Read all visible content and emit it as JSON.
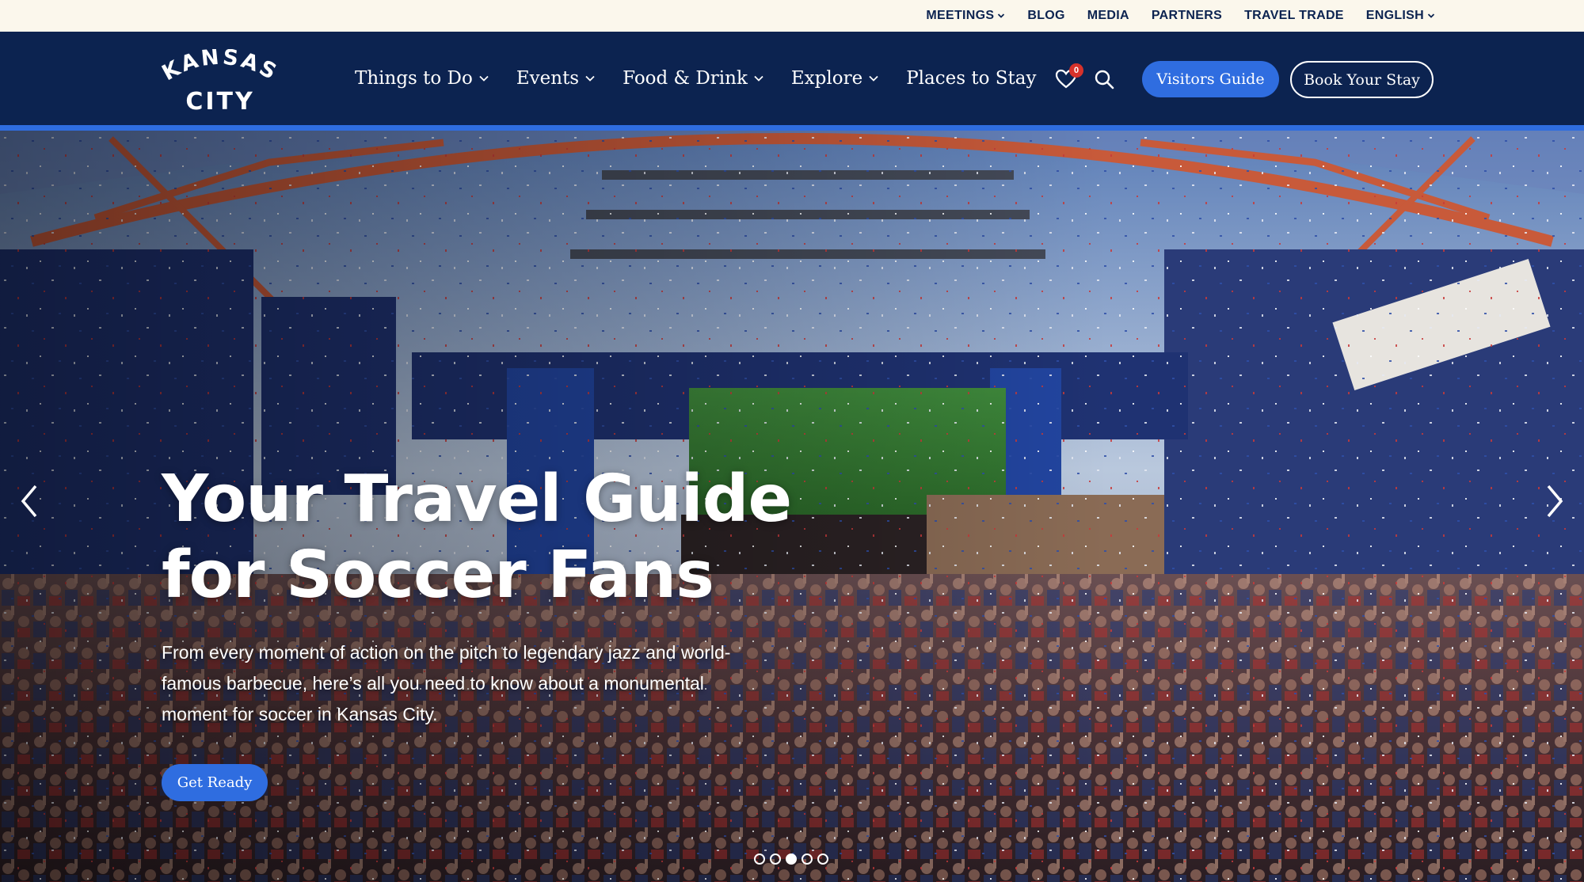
{
  "utility_nav": {
    "items": [
      {
        "label": "MEETINGS",
        "has_dropdown": true
      },
      {
        "label": "BLOG",
        "has_dropdown": false
      },
      {
        "label": "MEDIA",
        "has_dropdown": false
      },
      {
        "label": "PARTNERS",
        "has_dropdown": false
      },
      {
        "label": "TRAVEL TRADE",
        "has_dropdown": false
      },
      {
        "label": "ENGLISH",
        "has_dropdown": true
      }
    ]
  },
  "brand": {
    "logo_line1": "KANSAS",
    "logo_line2": "CITY"
  },
  "main_nav": {
    "items": [
      {
        "label": "Things to Do",
        "has_dropdown": true
      },
      {
        "label": "Events",
        "has_dropdown": true
      },
      {
        "label": "Food & Drink",
        "has_dropdown": true
      },
      {
        "label": "Explore",
        "has_dropdown": true
      },
      {
        "label": "Places to Stay",
        "has_dropdown": false
      }
    ],
    "favorites_count": "0",
    "visitors_guide_label": "Visitors Guide",
    "book_stay_label": "Book Your Stay"
  },
  "hero": {
    "title_line1": "Your Travel Guide",
    "title_line2": "for Soccer Fans",
    "subtitle": "From every moment of action on the pitch to legendary jazz and world-famous barbecue, here’s all you need to know about a monumental moment for soccer in Kansas City.",
    "cta_label": "Get Ready",
    "slides_total": 5,
    "active_slide": 3
  },
  "colors": {
    "navy": "#0c2350",
    "accent_blue": "#2f6de0",
    "cream": "#fbf7ec",
    "badge_red": "#d6322b"
  },
  "icons": {
    "heart": "heart-icon",
    "search": "search-icon",
    "prev": "chevron-left-icon",
    "next": "chevron-right-icon"
  }
}
